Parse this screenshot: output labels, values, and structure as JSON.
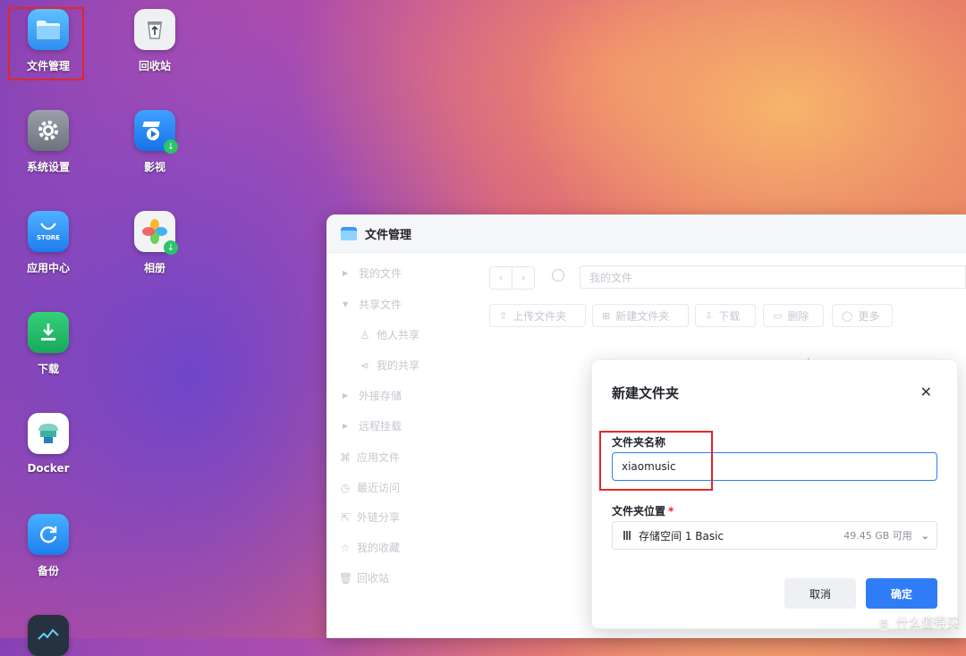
{
  "desktop": {
    "icons": [
      {
        "label": "文件管理"
      },
      {
        "label": "回收站"
      },
      {
        "label": "系统设置"
      },
      {
        "label": "影视"
      },
      {
        "label": "应用中心",
        "badge": "STORE"
      },
      {
        "label": "相册"
      },
      {
        "label": "下载"
      },
      {
        "label": "Docker"
      },
      {
        "label": "备份"
      }
    ]
  },
  "window": {
    "title": "文件管理",
    "sidebar": {
      "items": [
        {
          "label": "我的文件",
          "icon": "caret-right-icon"
        },
        {
          "label": "共享文件",
          "icon": "caret-down-icon"
        },
        {
          "label": "他人共享",
          "icon": "user-share-icon"
        },
        {
          "label": "我的共享",
          "icon": "share-icon"
        },
        {
          "label": "外接存储",
          "icon": "caret-right-icon"
        },
        {
          "label": "远程挂载",
          "icon": "caret-right-icon"
        },
        {
          "label": "应用文件",
          "icon": "apps-icon"
        },
        {
          "label": "最近访问",
          "icon": "clock-icon"
        },
        {
          "label": "外链分享",
          "icon": "link-share-icon"
        },
        {
          "label": "我的收藏",
          "icon": "star-icon"
        },
        {
          "label": "回收站",
          "icon": "trash-icon"
        }
      ]
    },
    "path": "我的文件",
    "toolbar": {
      "upload_folder": "上传文件夹",
      "new_folder": "新建文件夹",
      "download": "下载",
      "delete": "删除",
      "more": "更多"
    }
  },
  "dialog": {
    "title": "新建文件夹",
    "name_label": "文件夹名称",
    "name_value": "xiaomusic",
    "location_label": "文件夹位置",
    "location_value": "存储空间 1 Basic",
    "location_free": "49.45 GB 可用",
    "cancel": "取消",
    "confirm": "确定"
  },
  "watermark": "什么值得买",
  "colors": {
    "accent": "#2f7df6",
    "highlight": "#e0282a"
  }
}
